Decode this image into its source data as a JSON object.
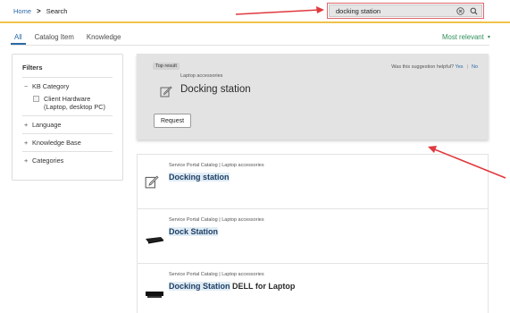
{
  "breadcrumb": {
    "home": "Home",
    "separator": ">",
    "current": "Search"
  },
  "search": {
    "value": "docking station",
    "clear_icon": "clear-circle-icon",
    "search_icon": "magnifier-icon"
  },
  "tabs": [
    {
      "label": "All",
      "active": true
    },
    {
      "label": "Catalog Item",
      "active": false
    },
    {
      "label": "Knowledge",
      "active": false
    }
  ],
  "sort": {
    "label": "Most relevant",
    "caret": "▾"
  },
  "filters": {
    "title": "Filters",
    "sections": [
      {
        "sign": "−",
        "label": "KB Category",
        "expanded": true,
        "options": [
          {
            "label": "Client Hardware (Laptop, desktop PC)",
            "checked": false
          }
        ]
      },
      {
        "sign": "+",
        "label": "Language",
        "expanded": false
      },
      {
        "sign": "+",
        "label": "Knowledge Base",
        "expanded": false
      },
      {
        "sign": "+",
        "label": "Categories",
        "expanded": false
      }
    ]
  },
  "top_result": {
    "badge": "Top result",
    "helpful_question": "Was this suggestion helpful?",
    "yes": "Yes",
    "separator": "|",
    "no": "No",
    "category": "Laptop accessories",
    "title": "Docking station",
    "icon": "edit-form-icon",
    "button": "Request"
  },
  "results": [
    {
      "category": "Service Portal Catalog | Laptop accessories",
      "title_highlight": "Docking station",
      "title_rest": "",
      "icon": "edit-form-icon"
    },
    {
      "category": "Service Portal Catalog | Laptop accessories",
      "title_highlight": "Dock Station",
      "title_rest": "",
      "icon": "docking-station-image"
    },
    {
      "category": "Service Portal Catalog | Laptop accessories",
      "title_highlight": "Docking Station",
      "title_rest": " DELL for Laptop",
      "icon": "dell-dock-image"
    }
  ],
  "colors": {
    "link": "#2c6aa8",
    "accent_line": "#f0c24a",
    "sort": "#2f8f5a",
    "annotation_arrow": "#e0393e"
  }
}
